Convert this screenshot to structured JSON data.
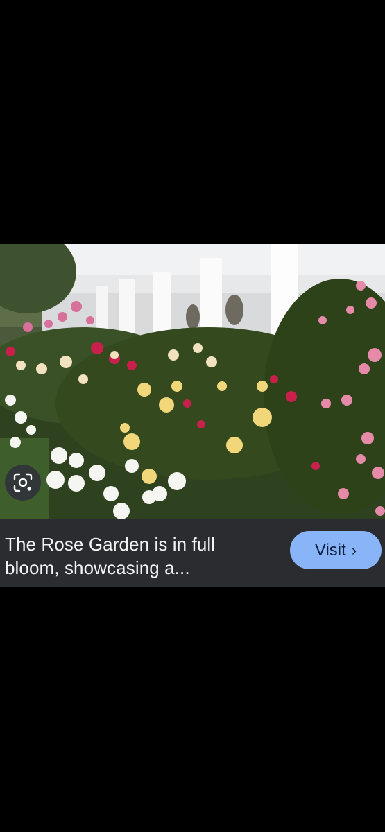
{
  "image": {
    "caption": "The Rose Garden is in full bloom, showcasing a..."
  },
  "actions": {
    "visit_label": "Visit",
    "visit_chevron": "›",
    "lens_icon": "lens-search-icon"
  },
  "colors": {
    "background": "#000000",
    "caption_bar": "#2b2c30",
    "visit_button": "#8ab4f8",
    "caption_text": "#f1f3f4"
  }
}
